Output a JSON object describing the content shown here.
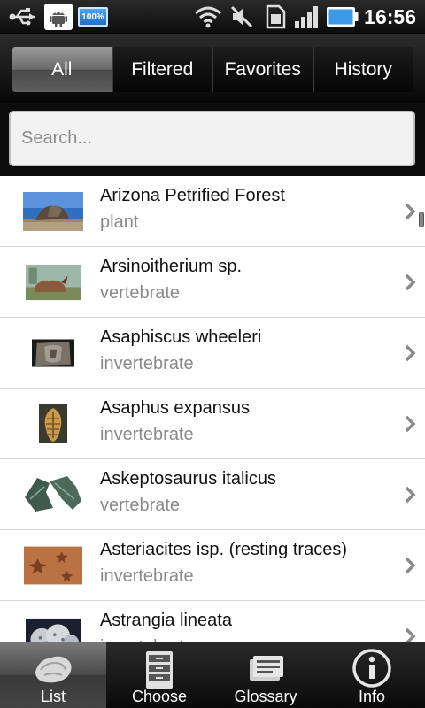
{
  "status_bar": {
    "time": "16:56",
    "battery_badge": "100%",
    "icons": [
      "usb-icon",
      "android-debug-icon",
      "battery-badge-icon",
      "wifi-icon",
      "mute-icon",
      "sim-icon",
      "signal-icon",
      "battery-icon"
    ]
  },
  "tabs": [
    {
      "label": "All",
      "active": true
    },
    {
      "label": "Filtered",
      "active": false
    },
    {
      "label": "Favorites",
      "active": false
    },
    {
      "label": "History",
      "active": false
    }
  ],
  "search": {
    "placeholder": "Search...",
    "value": ""
  },
  "list": [
    {
      "title": "Arizona Petrified Forest",
      "category": "plant"
    },
    {
      "title": "Arsinoitherium sp.",
      "category": "vertebrate"
    },
    {
      "title": "Asaphiscus wheeleri",
      "category": "invertebrate"
    },
    {
      "title": "Asaphus expansus",
      "category": "invertebrate"
    },
    {
      "title": "Askeptosaurus italicus",
      "category": "vertebrate"
    },
    {
      "title": "Asteriacites isp. (resting traces)",
      "category": "invertebrate"
    },
    {
      "title": "Astrangia lineata",
      "category": "invertebrate"
    }
  ],
  "bottom_nav": [
    {
      "label": "List",
      "icon": "fossil-icon",
      "active": true
    },
    {
      "label": "Choose",
      "icon": "cabinet-icon",
      "active": false
    },
    {
      "label": "Glossary",
      "icon": "book-icon",
      "active": false
    },
    {
      "label": "Info",
      "icon": "info-icon",
      "active": false
    }
  ],
  "colors": {
    "background": "#000000",
    "list_background": "#ffffff",
    "subtitle": "#8a8a8a",
    "divider": "#d6d6d6"
  }
}
